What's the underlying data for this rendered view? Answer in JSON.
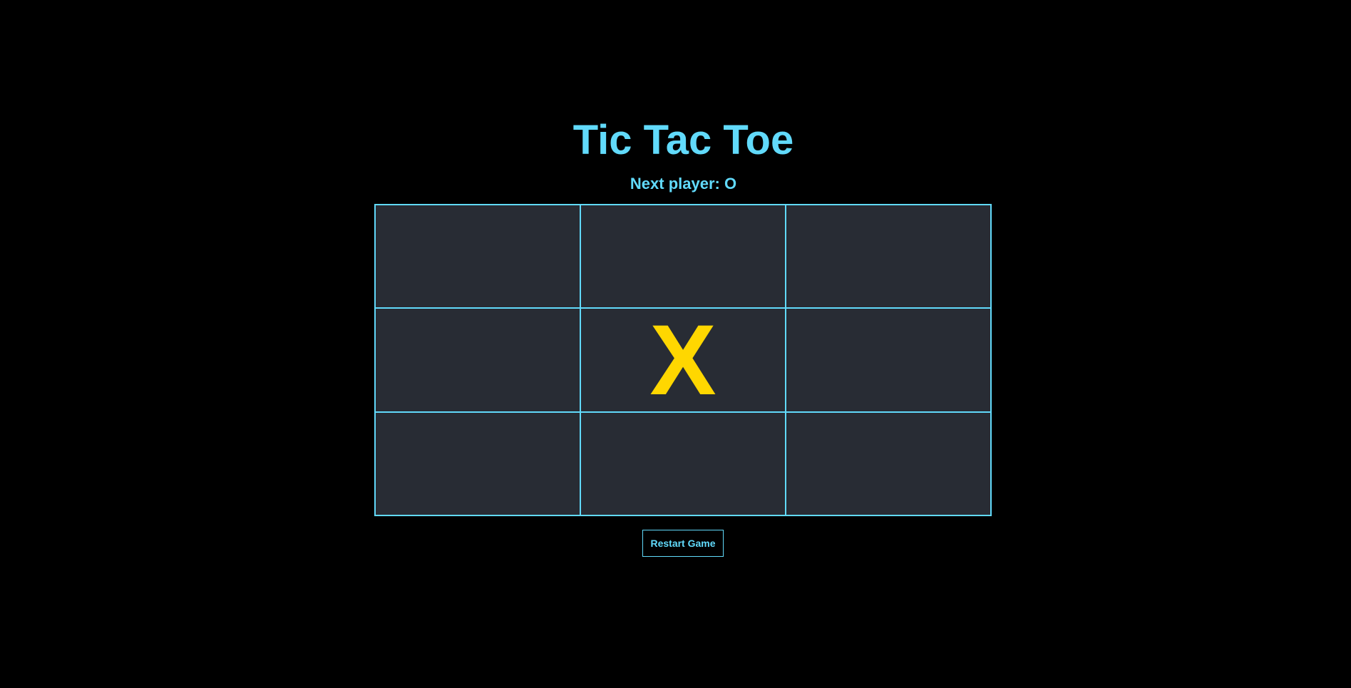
{
  "title": "Tic Tac Toe",
  "status": "Next player: O",
  "board": {
    "cells": [
      "",
      "",
      "",
      "",
      "X",
      "",
      "",
      "",
      ""
    ]
  },
  "restart_label": "Restart Game",
  "colors": {
    "background": "#000000",
    "accent": "#61dafb",
    "cell_background": "#282c34",
    "mark": "#ffd700"
  }
}
